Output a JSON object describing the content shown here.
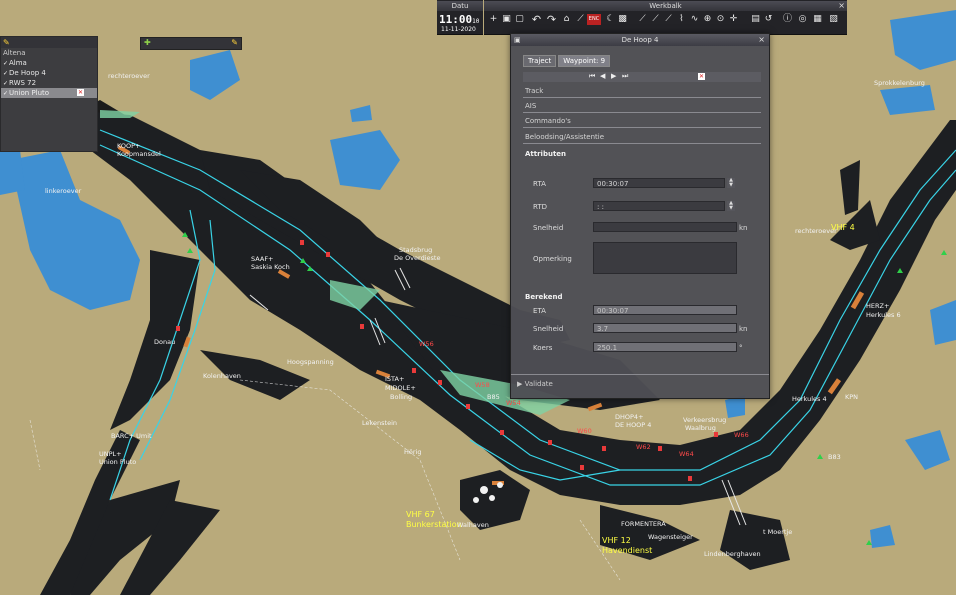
{
  "toolbar_left": {
    "title": "Datu",
    "clock": "11:00",
    "clock_seconds": "10",
    "date": "11-11-2020"
  },
  "toolbar_right": {
    "title": "Werkbalk",
    "enc_label": "ENC"
  },
  "layers": {
    "items": [
      {
        "label": "Altena",
        "checked": false
      },
      {
        "label": "Alma",
        "checked": true
      },
      {
        "label": "De Hoop 4",
        "checked": true
      },
      {
        "label": "RWS 72",
        "checked": true
      },
      {
        "label": "Union Pluto",
        "checked": true,
        "selected": true
      }
    ]
  },
  "dialog": {
    "title": "De Hoop 4",
    "tabs": [
      "Traject",
      "Waypoint: 9"
    ],
    "sections": [
      "Track",
      "AIS",
      "Commando's",
      "Beloodsing/Assistentie"
    ],
    "attributes_heading": "Attributen",
    "rta_label": "RTA",
    "rta_value": "00:30:07",
    "rtd_label": "RTD",
    "rtd_value": " : :",
    "speed_label": "Snelheid",
    "speed_unit": "kn",
    "remark_label": "Opmerking",
    "calc_heading": "Berekend",
    "eta_label": "ETA",
    "eta_value": "00:30:07",
    "calc_speed_label": "Snelheid",
    "calc_speed_value": "3.7",
    "calc_speed_unit": "kn",
    "course_label": "Koers",
    "course_value": "250.1",
    "course_unit": "°",
    "validate_label": "Validate"
  },
  "map_labels": [
    {
      "text": "rechteroever",
      "style": ""
    },
    {
      "text": "linkeroever",
      "style": ""
    },
    {
      "text": "rechteroever",
      "style": ""
    },
    {
      "text": "Sprokkelenburg",
      "style": ""
    },
    {
      "text": "KOOP+",
      "style": ""
    },
    {
      "text": "Koopmansdel",
      "style": ""
    },
    {
      "text": "SAAF+",
      "style": ""
    },
    {
      "text": "Saskia Koch",
      "style": ""
    },
    {
      "text": "Stadsbrug",
      "style": ""
    },
    {
      "text": "De Overdieste",
      "style": ""
    },
    {
      "text": "Hoogspanning",
      "style": ""
    },
    {
      "text": "ISTA+",
      "style": ""
    },
    {
      "text": "MIDOLE+",
      "style": ""
    },
    {
      "text": "Bolling",
      "style": ""
    },
    {
      "text": "Lekenstein",
      "style": ""
    },
    {
      "text": "Hörig",
      "style": ""
    },
    {
      "text": "BARC+ Umit",
      "style": ""
    },
    {
      "text": "UNPL+",
      "style": ""
    },
    {
      "text": "Union Pluto",
      "style": ""
    },
    {
      "text": "VHF 67",
      "style": "yel"
    },
    {
      "text": "Bunkerstation",
      "style": "yel"
    },
    {
      "text": "VHF 12",
      "style": "yel"
    },
    {
      "text": "Havendienst",
      "style": "yel"
    },
    {
      "text": "Walhaven",
      "style": ""
    },
    {
      "text": "FORMENTERA",
      "style": ""
    },
    {
      "text": "Lindenberghaven",
      "style": ""
    },
    {
      "text": "Wagensteiger",
      "style": ""
    },
    {
      "text": "t Moertje",
      "style": ""
    },
    {
      "text": "Verkeersbrug",
      "style": ""
    },
    {
      "text": "Waalbrug",
      "style": ""
    },
    {
      "text": "DHOP4+",
      "style": ""
    },
    {
      "text": "DE HOOP 4",
      "style": ""
    },
    {
      "text": "HERZ+",
      "style": ""
    },
    {
      "text": "Herkules 6",
      "style": ""
    },
    {
      "text": "Herkules 4",
      "style": ""
    },
    {
      "text": "KPN",
      "style": ""
    },
    {
      "text": "W56",
      "style": "red"
    },
    {
      "text": "W58",
      "style": "red"
    },
    {
      "text": "W60",
      "style": "red"
    },
    {
      "text": "W62",
      "style": "red"
    },
    {
      "text": "W64",
      "style": "red"
    },
    {
      "text": "W66",
      "style": "red"
    },
    {
      "text": "W54",
      "style": "red"
    },
    {
      "text": "B83",
      "style": ""
    },
    {
      "text": "B85",
      "style": ""
    },
    {
      "text": "VHF 4",
      "style": "yel"
    },
    {
      "text": "Kolenhaven",
      "style": ""
    },
    {
      "text": "Donau",
      "style": ""
    },
    {
      "text": "Altena",
      "style": ""
    }
  ]
}
